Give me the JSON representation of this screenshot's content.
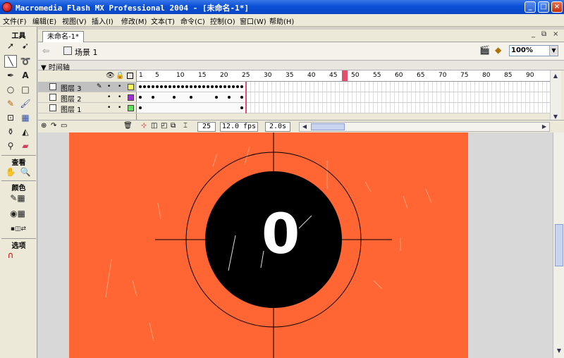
{
  "window": {
    "title": "Macromedia Flash MX Professional 2004 - [未命名-1*]",
    "minimize": "_",
    "maximize": "□",
    "close": "×"
  },
  "menu": [
    "文件(F)",
    "编辑(E)",
    "视图(V)",
    "插入(I)",
    "修改(M)",
    "文本(T)",
    "命令(C)",
    "控制(O)",
    "窗口(W)",
    "帮助(H)"
  ],
  "tools": {
    "section_tools": "工具",
    "section_view": "查看",
    "section_colors": "颜色",
    "section_options": "选项"
  },
  "document": {
    "tab": "未命名-1*",
    "scene": "场景 1",
    "zoom": "100%",
    "ctrl_min": "_",
    "ctrl_restore": "⧉",
    "ctrl_close": "×"
  },
  "timeline": {
    "header": "▼ 时间轴",
    "ruler": [
      "1",
      "5",
      "10",
      "15",
      "20",
      "25",
      "30",
      "35",
      "40",
      "45",
      "50",
      "55",
      "60",
      "65",
      "70",
      "75",
      "80",
      "85",
      "90"
    ],
    "layers": [
      {
        "name": "图层 3",
        "color": "#ffff66",
        "selected": true
      },
      {
        "name": "图层 2",
        "color": "#9933cc",
        "selected": false
      },
      {
        "name": "图层 1",
        "color": "#66dd66",
        "selected": false
      }
    ],
    "current_frame": "25",
    "fps": "12.0 fps",
    "time": "2.0s"
  },
  "stage": {
    "background": "#ff6633",
    "counter": "0"
  }
}
